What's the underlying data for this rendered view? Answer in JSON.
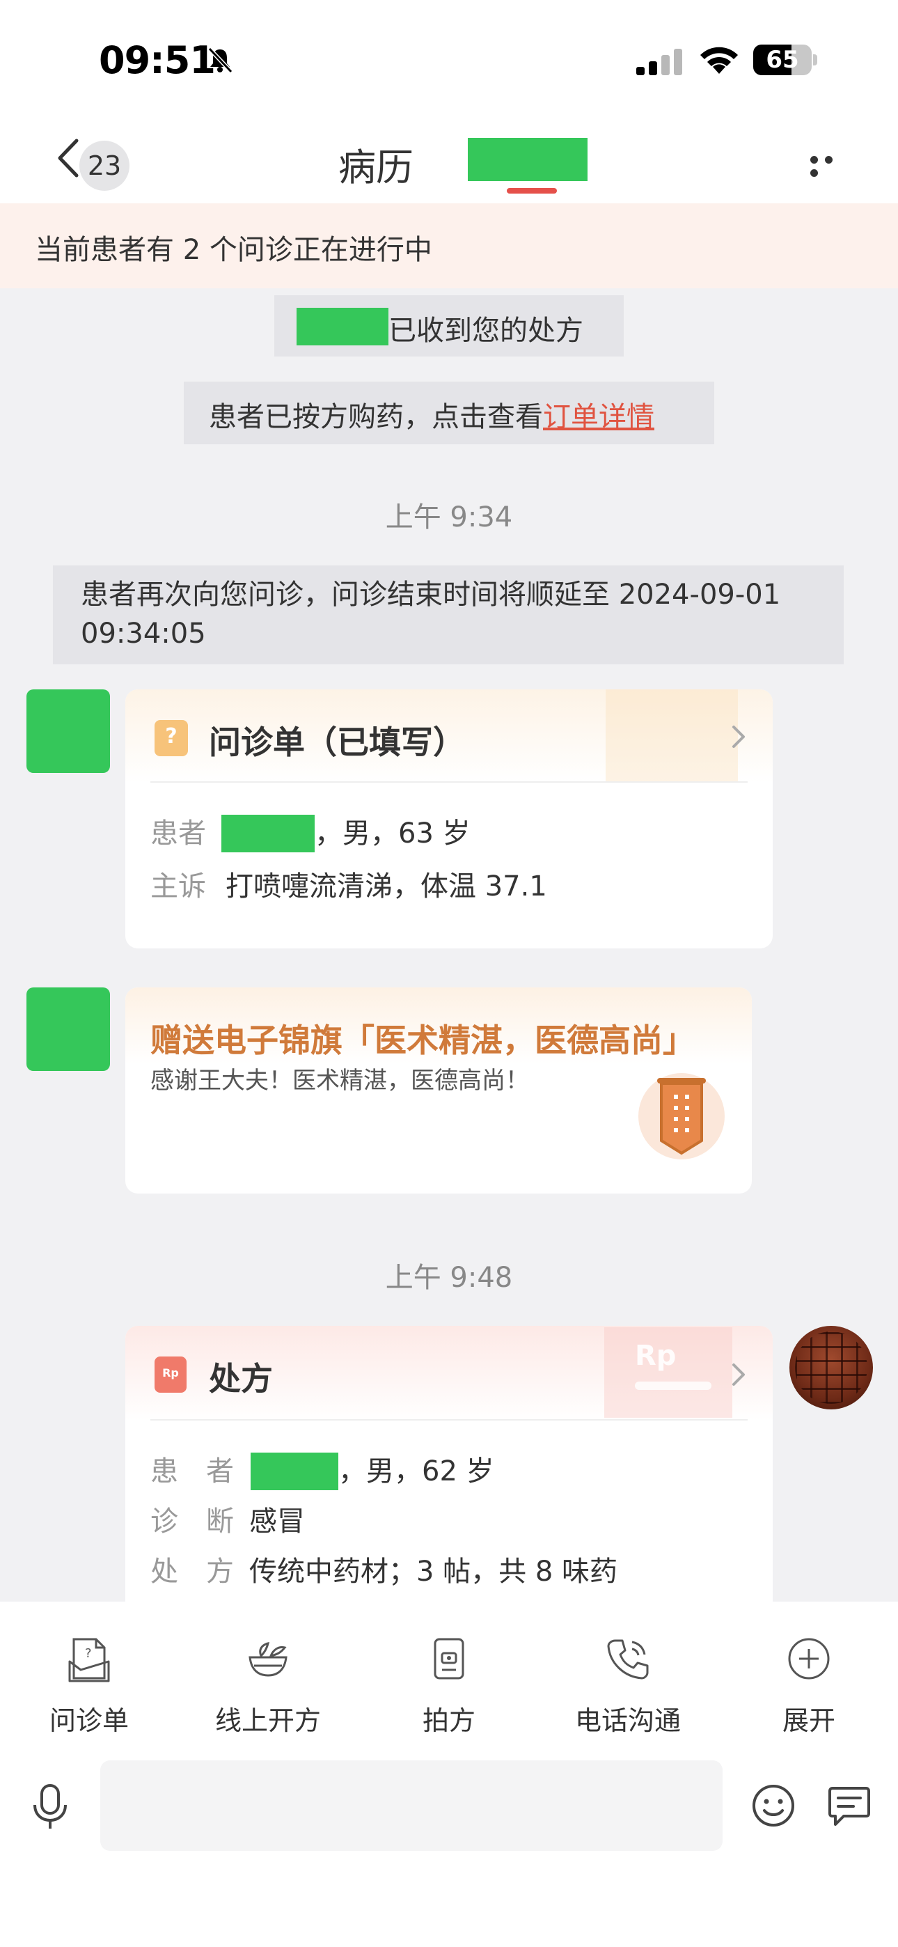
{
  "status_bar": {
    "time": "09:51",
    "battery": "65",
    "battery_level": 0.65
  },
  "nav": {
    "back_badge": "23",
    "title": "病历"
  },
  "banner": {
    "text": "当前患者有 2 个问诊正在进行中"
  },
  "messages": {
    "prescription_received": "已收到您的处方",
    "purchased_prefix": "患者已按方购药，点击查看",
    "order_link": "订单详情",
    "time1": "上午 9:34",
    "extended_notice": "患者再次向您问诊，问诊结束时间将顺延至 2024-09-01 09:34:05",
    "time2": "上午 9:48"
  },
  "consult_card": {
    "title": "问诊单（已填写）",
    "patient_label": "患者",
    "patient_info": "，男，63 岁",
    "complaint_label": "主诉",
    "complaint_value": "打喷嚏流清涕，体温 37.1"
  },
  "pennant_card": {
    "title": "赠送电子锦旗「医术精湛，医德高尚」",
    "message": "感谢王大夫！医术精湛，医德高尚！"
  },
  "prescription_card": {
    "title": "处方",
    "deco_text": "Rp",
    "patient_label": "患　者",
    "patient_info": "，男，62 岁",
    "diagnosis_label": "诊　断",
    "diagnosis_value": "感冒",
    "rx_label": "处　方",
    "rx_value": "传统中药材；3 帖，共 8 味药"
  },
  "toolbar": [
    {
      "label": "问诊单",
      "icon": "consult-form-icon"
    },
    {
      "label": "线上开方",
      "icon": "herb-bowl-icon"
    },
    {
      "label": "拍方",
      "icon": "camera-rx-icon"
    },
    {
      "label": "电话沟通",
      "icon": "phone-icon"
    },
    {
      "label": "展开",
      "icon": "plus-circle-icon"
    }
  ],
  "colors": {
    "accent_red": "#e5504a",
    "link": "#e05340",
    "pennant_title": "#d07a3a",
    "redacted_green": "#35c75a"
  }
}
